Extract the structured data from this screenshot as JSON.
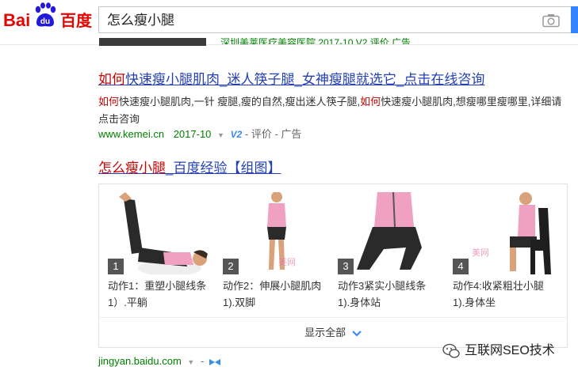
{
  "header": {
    "logo_bai": "Bai",
    "logo_du": "du",
    "logo_cn": "百度",
    "search_query": "怎么瘦小腿"
  },
  "prev_result": {
    "url_line": "深圳美莱医疗美容医院 2017-10 V2 评价 广告"
  },
  "result1": {
    "title_hl": "如何",
    "title_rest": "快速瘦小腿肌肉_迷人筷子腿_女神瘦腿就选它_点击在线咨询",
    "snippet_hl1": "如何",
    "snippet_mid": "快速瘦小腿肌肉,一针 瘦腿,瘦的自然,瘦出迷人筷子腿,",
    "snippet_hl2": "如何",
    "snippet_end": "快速瘦小腿肌肉,想瘦哪里瘦哪里,详细请点击咨询",
    "url": "www.kemei.cn",
    "date": "2017-10",
    "v_badge": "V2",
    "rating": "- 评价 - 广告"
  },
  "result2": {
    "title_hl": "怎么瘦小腿",
    "title_rest": "_百度经验【组图】",
    "steps": [
      {
        "num": "1",
        "caption": "动作1：重塑小腿线条　　1）.平躺"
      },
      {
        "num": "2",
        "caption": "动作2：伸展小腿肌肉　　1).双脚"
      },
      {
        "num": "3",
        "caption": "动作3紧实小腿线条　　1).身体站"
      },
      {
        "num": "4",
        "caption": "动作4:收紧粗壮小腿　　1).身体坐"
      }
    ],
    "show_all": "显示全部",
    "url": "jingyan.baidu.com",
    "url_suffix": "-"
  },
  "watermark": "互联网SEO技术",
  "colors": {
    "baidu_red": "#e10601",
    "baidu_blue": "#2319dc",
    "link_blue": "#2440b3",
    "highlight_red": "#cc0000",
    "url_green": "#008000",
    "search_btn": "#3385ff"
  }
}
